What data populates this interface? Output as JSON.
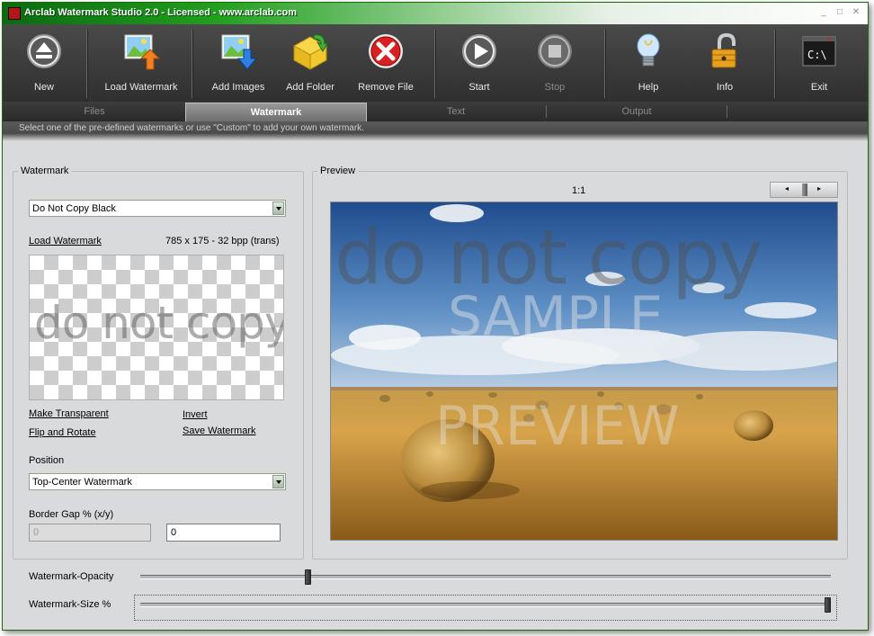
{
  "window": {
    "title": "Arclab Watermark Studio 2.0 - Licensed - www.arclab.com"
  },
  "toolbar": {
    "buttons": [
      {
        "label": "New",
        "icon": "eject-icon"
      },
      {
        "label": "Load Watermark",
        "icon": "image-load-icon"
      },
      {
        "label": "Add Images",
        "icon": "image-add-icon"
      },
      {
        "label": "Add Folder",
        "icon": "folder-add-icon"
      },
      {
        "label": "Remove File",
        "icon": "remove-icon"
      },
      {
        "label": "Start",
        "icon": "play-icon"
      },
      {
        "label": "Stop",
        "icon": "stop-icon"
      },
      {
        "label": "Help",
        "icon": "lightbulb-icon"
      },
      {
        "label": "Info",
        "icon": "padlock-icon"
      },
      {
        "label": "Exit",
        "icon": "terminal-icon"
      }
    ]
  },
  "tabs": [
    {
      "label": "Files",
      "active": false
    },
    {
      "label": "Watermark",
      "active": true
    },
    {
      "label": "Text",
      "active": false
    },
    {
      "label": "Output",
      "active": false
    }
  ],
  "hint": "Select one of the pre-defined watermarks or use \"Custom\" to add your own watermark.",
  "watermark": {
    "group_label": "Watermark",
    "selected": "Do Not Copy Black",
    "load_link": "Load Watermark",
    "info": "785 x 175 - 32 bpp (trans)",
    "sample_text": "do not copy",
    "make_transparent": "Make Transparent",
    "invert": "Invert",
    "flip_rotate": "Flip and Rotate",
    "save_watermark": "Save Watermark",
    "position_label": "Position",
    "position_value": "Top-Center Watermark",
    "border_gap_label": "Border Gap % (x/y)",
    "gap_x": "0",
    "gap_y": "0"
  },
  "preview": {
    "group_label": "Preview",
    "zoom": "1:1",
    "overlay_main": "do not copy",
    "overlay_sample": "SAMPLE",
    "overlay_preview": "PREVIEW"
  },
  "sliders": {
    "opacity_label": "Watermark-Opacity",
    "opacity_value": 0.24,
    "size_label": "Watermark-Size %",
    "size_value": 1.0
  }
}
